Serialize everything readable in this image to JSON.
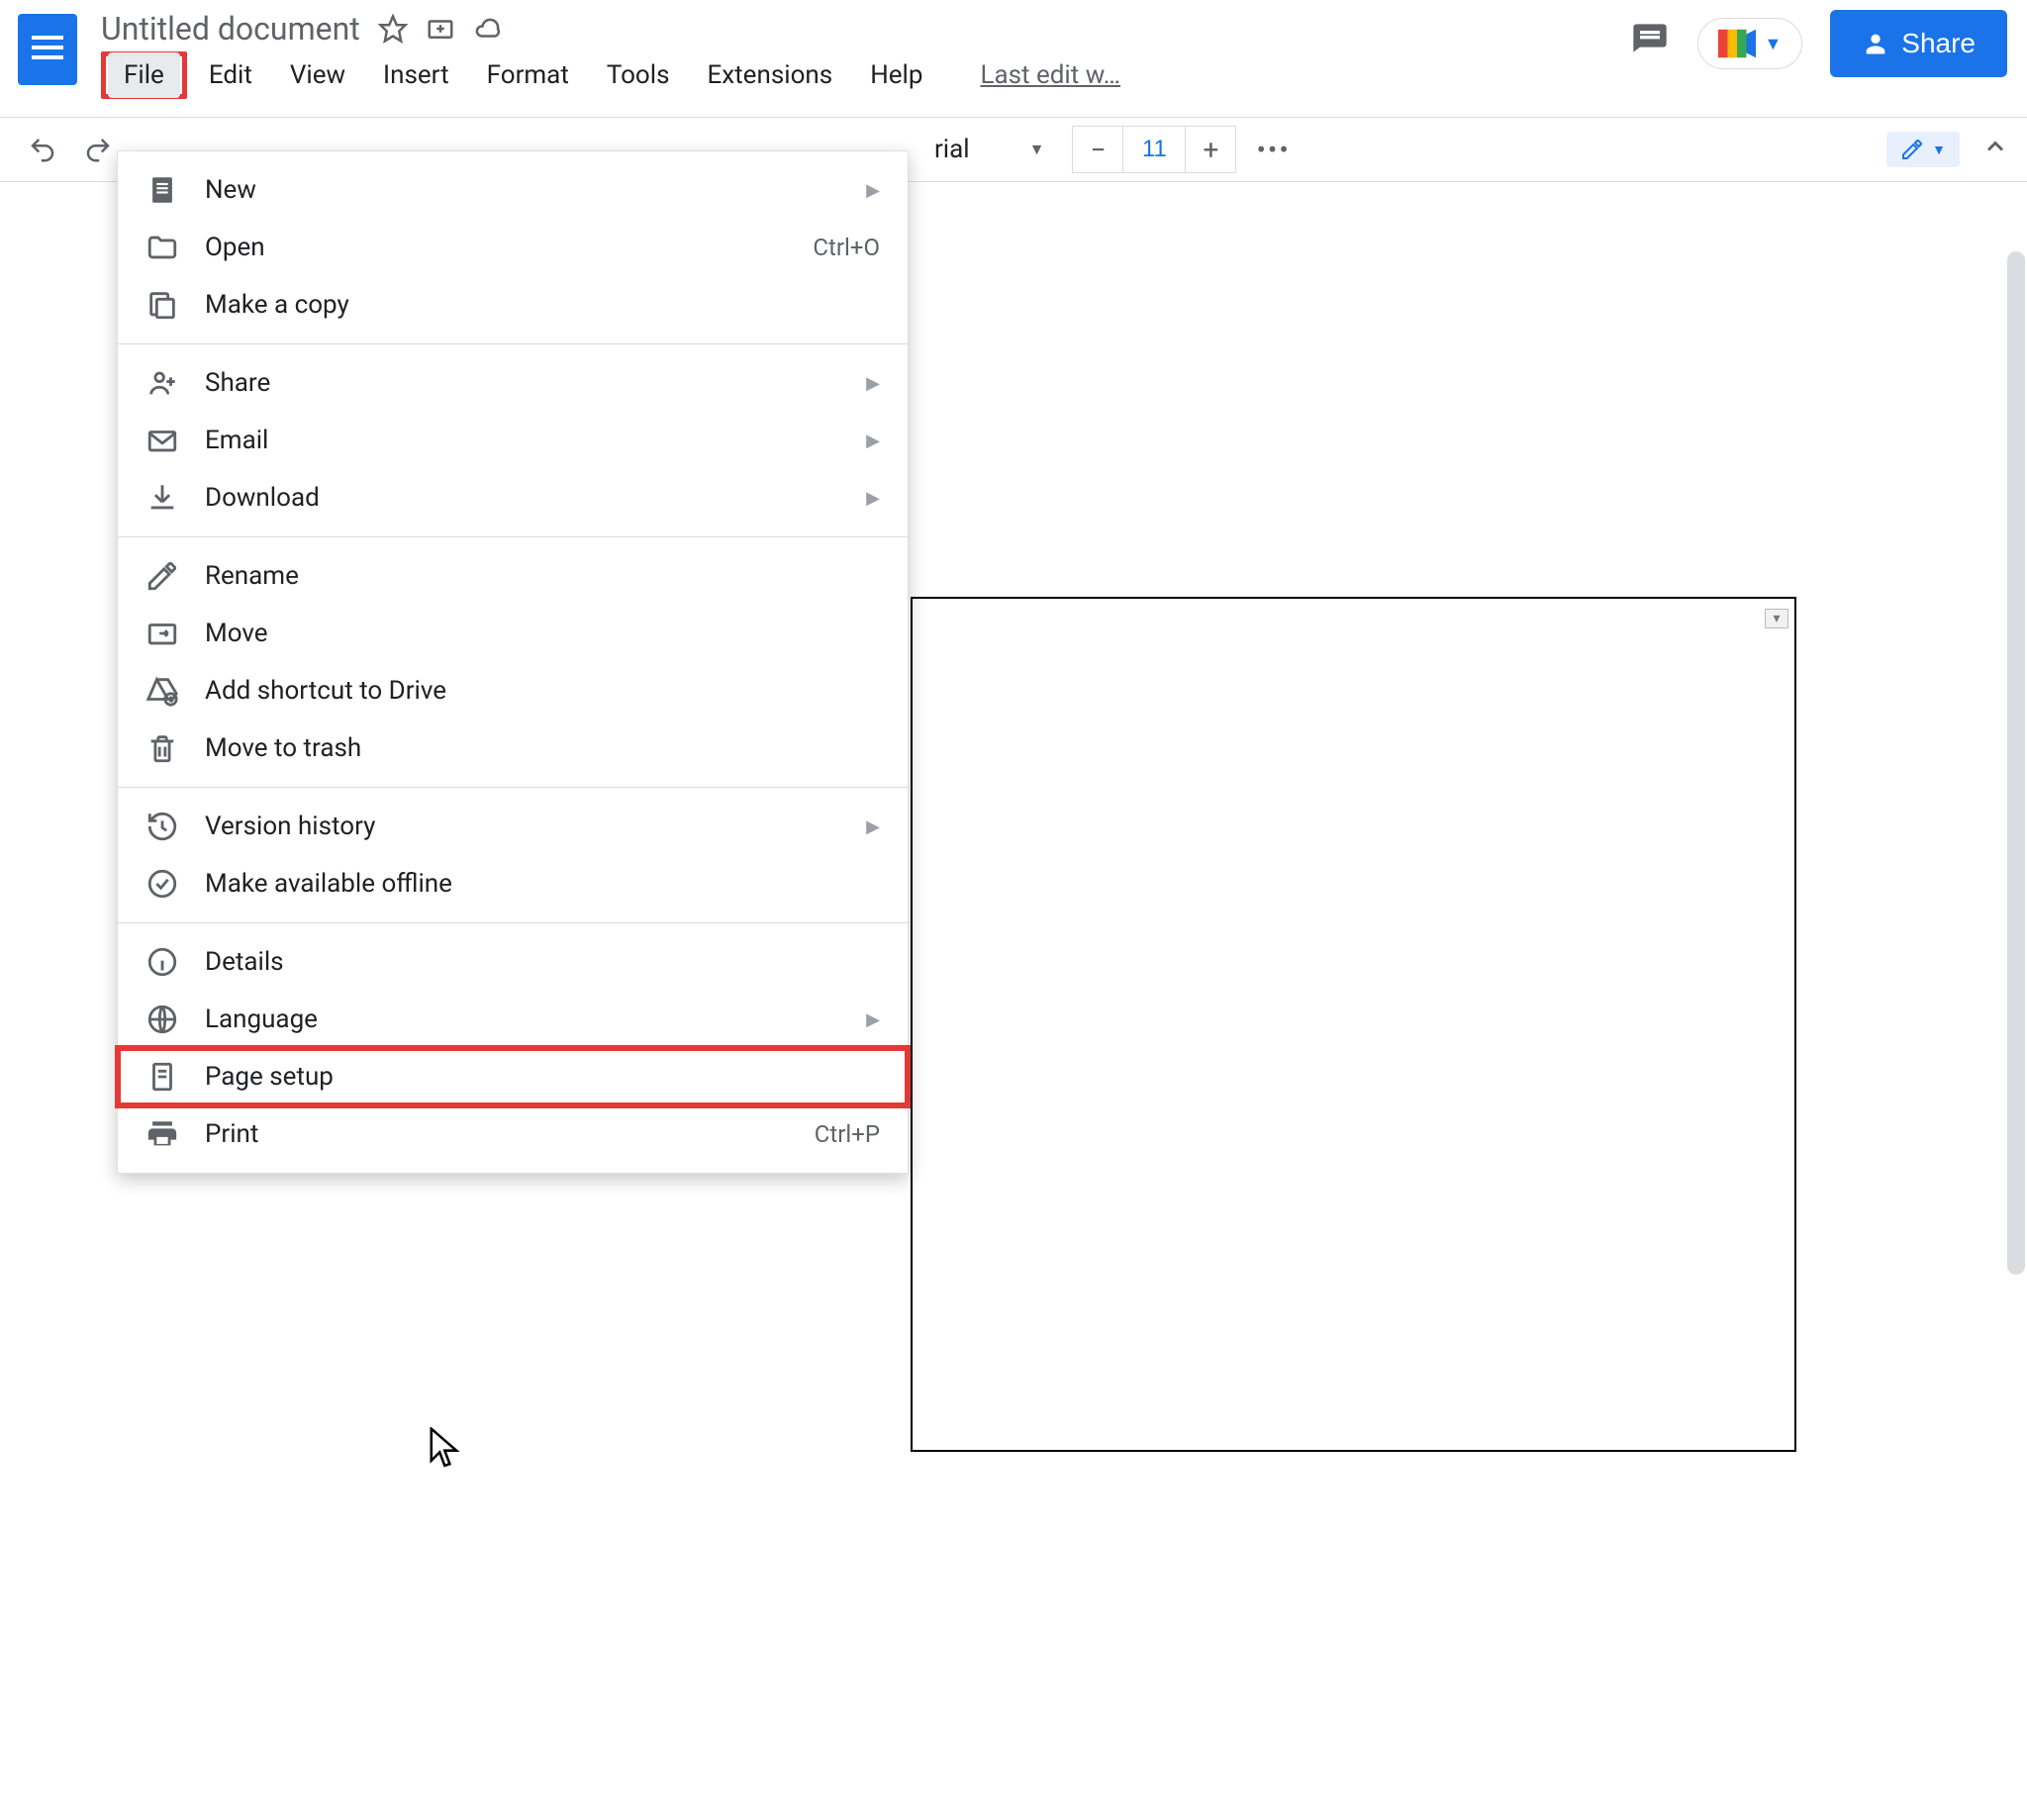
{
  "header": {
    "title": "Untitled document",
    "share_label": "Share",
    "last_edit": "Last edit w…"
  },
  "menubar": {
    "items": [
      "File",
      "Edit",
      "View",
      "Insert",
      "Format",
      "Tools",
      "Extensions",
      "Help"
    ],
    "active": "File"
  },
  "toolbar": {
    "font_visible": "rial",
    "font_size": "11"
  },
  "dropdown": {
    "groups": [
      [
        {
          "icon": "doc-icon",
          "label": "New",
          "shortcut": "",
          "submenu": true
        },
        {
          "icon": "folder-icon",
          "label": "Open",
          "shortcut": "Ctrl+O"
        },
        {
          "icon": "copy-icon",
          "label": "Make a copy",
          "shortcut": ""
        }
      ],
      [
        {
          "icon": "person-add-icon",
          "label": "Share",
          "submenu": true
        },
        {
          "icon": "mail-icon",
          "label": "Email",
          "submenu": true
        },
        {
          "icon": "download-icon",
          "label": "Download",
          "submenu": true
        }
      ],
      [
        {
          "icon": "pencil-icon",
          "label": "Rename"
        },
        {
          "icon": "move-icon",
          "label": "Move"
        },
        {
          "icon": "drive-add-icon",
          "label": "Add shortcut to Drive"
        },
        {
          "icon": "trash-icon",
          "label": "Move to trash"
        }
      ],
      [
        {
          "icon": "history-icon",
          "label": "Version history",
          "submenu": true
        },
        {
          "icon": "offline-icon",
          "label": "Make available offline"
        }
      ],
      [
        {
          "icon": "info-icon",
          "label": "Details"
        },
        {
          "icon": "globe-icon",
          "label": "Language",
          "submenu": true
        },
        {
          "icon": "page-icon",
          "label": "Page setup",
          "highlighted": true
        },
        {
          "icon": "print-icon",
          "label": "Print",
          "shortcut": "Ctrl+P"
        }
      ]
    ]
  }
}
